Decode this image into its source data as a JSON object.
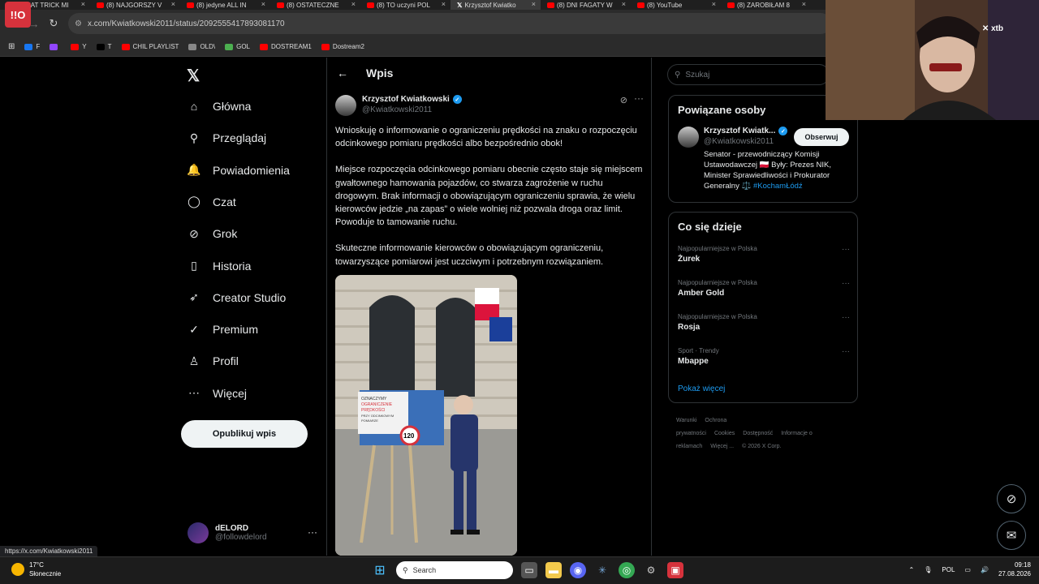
{
  "browser": {
    "tabs": [
      {
        "label": "(8) HAT TRICK MI",
        "kind": "youtube"
      },
      {
        "label": "(8) NAJGORSZY V",
        "kind": "youtube"
      },
      {
        "label": "(8) jedyne ALL IN",
        "kind": "youtube"
      },
      {
        "label": "(8) OSTATECZNE",
        "kind": "youtube"
      },
      {
        "label": "(8) TO uczyni POL",
        "kind": "youtube"
      },
      {
        "label": "Krzysztof Kwiatko",
        "kind": "x",
        "active": true
      },
      {
        "label": "(8) DNI FAGATY W",
        "kind": "youtube"
      },
      {
        "label": "(8) YouTube",
        "kind": "youtube"
      },
      {
        "label": "(8) ZAROBIŁAM 8",
        "kind": "youtube"
      }
    ],
    "url": "x.com/Kwiatkowski2011/status/2092555417893081170",
    "bookmarks": [
      {
        "label": "F",
        "color": "#1877f2"
      },
      {
        "label": "",
        "color": "#9146ff"
      },
      {
        "label": "Y",
        "color": "#ff0000"
      },
      {
        "label": "T",
        "color": "#000000"
      },
      {
        "label": "CHIL PLAYLIST",
        "color": "#ff0000"
      },
      {
        "label": "OLD\\",
        "color": "#888888"
      },
      {
        "label": "GOL",
        "color": "#4caf50"
      },
      {
        "label": "DOSTREAM1",
        "color": "#ff0000"
      },
      {
        "label": "Dostream2",
        "color": "#ff0000"
      }
    ],
    "logo_badge": "!!O",
    "status_url": "https://x.com/Kwiatkowski2011"
  },
  "sidenav": {
    "items": [
      {
        "label": "Główna",
        "icon": "home-icon",
        "glyph": "⌂"
      },
      {
        "label": "Przeglądaj",
        "icon": "search-icon",
        "glyph": "⚲"
      },
      {
        "label": "Powiadomienia",
        "icon": "bell-icon",
        "glyph": "🔔"
      },
      {
        "label": "Czat",
        "icon": "chat-icon",
        "glyph": "◯"
      },
      {
        "label": "Grok",
        "icon": "grok-icon",
        "glyph": "⊘"
      },
      {
        "label": "Historia",
        "icon": "bookmark-icon",
        "glyph": "▯"
      },
      {
        "label": "Creator Studio",
        "icon": "rocket-icon",
        "glyph": "➶"
      },
      {
        "label": "Premium",
        "icon": "premium-icon",
        "glyph": "✓"
      },
      {
        "label": "Profil",
        "icon": "person-icon",
        "glyph": "♙"
      },
      {
        "label": "Więcej",
        "icon": "more-icon",
        "glyph": "⋯"
      }
    ],
    "post_button": "Opublikuj wpis",
    "me": {
      "name": "dELORD",
      "handle": "@followdelord",
      "more": "···"
    }
  },
  "main": {
    "back": "←",
    "title": "Wpis",
    "author": {
      "name": "Krzysztof Kwiatkowski",
      "handle": "@Kwiatkowski2011"
    },
    "paragraphs": [
      "Wnioskuję o informowanie o ograniczeniu prędkości na znaku o rozpoczęciu odcinkowego pomiaru prędkości albo bezpośrednio obok!",
      "Miejsce rozpoczęcia odcinkowego pomiaru obecnie często staje się miejscem gwałtownego hamowania pojazdów, co stwarza zagrożenie w ruchu drogowym. Brak informacji o obowiązującym ograniczeniu sprawia, że wielu kierowców jedzie „na zapas” o wiele wolniej niż pozwala droga oraz limit. Powoduje to tamowanie ruchu.",
      "Skuteczne informowanie kierowców o obowiązującym ograniczeniu, towarzyszące pomiarowi jest uczciwym i potrzebnym rozwiązaniem."
    ],
    "image_sign": {
      "line1": "OZNACZYMY",
      "line2": "OGRANICZENIE",
      "line3": "PRĘDKOŚCI",
      "line4": "PRZY ODCINKOWYM",
      "line5": "POMIARZE",
      "speed": "120"
    }
  },
  "right": {
    "search_placeholder": "Szukaj",
    "related_title": "Powiązane osoby",
    "related": {
      "name": "Krzysztof Kwiatk...",
      "handle": "@Kwiatkowski2011",
      "follow": "Obserwuj",
      "bio_text": "Senator - przewodniczący Komisji Ustawodawczej 🇵🇱 Były: Prezes NIK, Minister Sprawiedliwości i Prokurator Generalny ⚖️",
      "bio_tag": "#KochamŁódź"
    },
    "trends_title": "Co się dzieje",
    "trends": [
      {
        "context": "Najpopularniejsze w Polska",
        "name": "Żurek"
      },
      {
        "context": "Najpopularniejsze w Polska",
        "name": "Amber Gold"
      },
      {
        "context": "Najpopularniejsze w Polska",
        "name": "Rosja"
      },
      {
        "context": "Sport · Trendy",
        "name": "Mbappe"
      }
    ],
    "show_more": "Pokaż więcej",
    "footer": [
      "Warunki",
      "Ochrona prywatności",
      "Cookies",
      "Dostępność",
      "Informacje o reklamach",
      "Więcej ...",
      "© 2026 X Corp."
    ]
  },
  "webcam": {
    "overlay": "xtb"
  },
  "taskbar": {
    "weather_temp": "17°C",
    "weather_desc": "Słonecznie",
    "search": "Search",
    "lang": "POL",
    "time": "09:18",
    "date": "27.08.2026"
  }
}
